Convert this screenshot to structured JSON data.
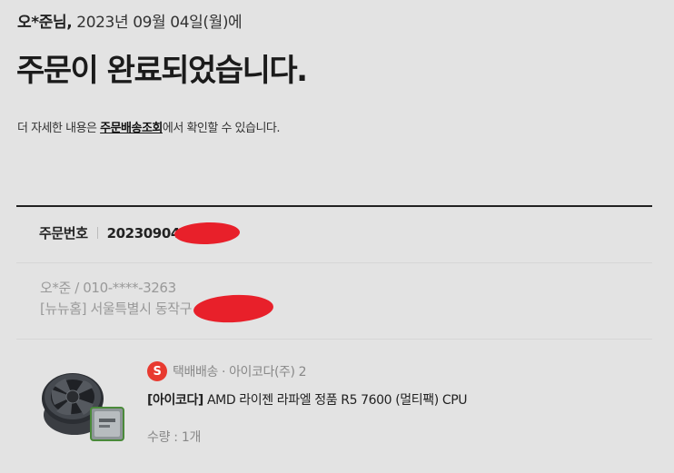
{
  "greeting": {
    "name": "오*준님,",
    "date_text": "2023년 09월 04일(월)에"
  },
  "title": "주문이 완료되었습니다.",
  "notice": {
    "prefix": "더 자세한 내용은 ",
    "link": "주문배송조회",
    "suffix": "에서 확인할 수 있습니다."
  },
  "order": {
    "label": "주문번호",
    "number_visible": "20230904"
  },
  "recipient": {
    "name_phone": "오*준 / 010-****-3263",
    "address": "[뉴뉴홈] 서울특별시 동작구"
  },
  "product": {
    "seller_badge": "S",
    "seller_text": "택배배송 · 아이코다(주) 2",
    "brand": "[아이코다]",
    "name": " AMD 라이젠 라파엘 정품 R5 7600 (멀티팩) CPU",
    "quantity": "수량 : 1개",
    "image_icon": "cpu-cooler-product-image"
  },
  "colors": {
    "background": "#e3e3e3",
    "seller_badge": "#e83a30",
    "redaction": "#e8202a"
  }
}
